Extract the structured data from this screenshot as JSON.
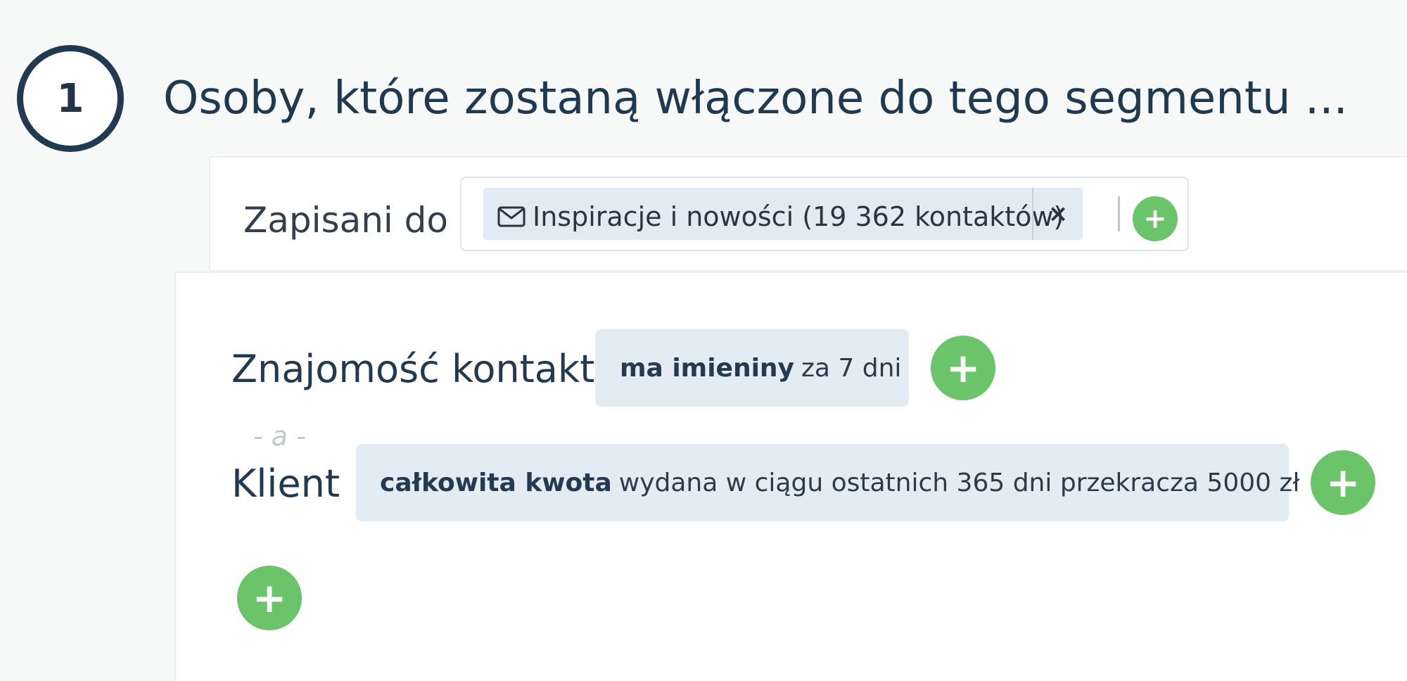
{
  "step": {
    "number": "1",
    "title": "Osoby, które zostaną włączone do tego segmentu ..."
  },
  "subscribed": {
    "label": "Zapisani do",
    "tag_text": "Inspiracje i nowości (19 362 kontaktów)",
    "remove_symbol": "×",
    "add_symbol": "+"
  },
  "conditions": [
    {
      "label": "Znajomość kontaktu",
      "bold": "ma imieniny",
      "rest": "za 7 dni",
      "add_symbol": "+"
    },
    {
      "label": "Klient",
      "bold": "całkowita kwota",
      "rest": "wydana w ciągu ostatnich 365 dni przekracza 5000 zł",
      "add_symbol": "+"
    }
  ],
  "connector": "- a -",
  "add_group_symbol": "+",
  "icons": {
    "list_tag": "envelope-icon"
  },
  "colors": {
    "accent_green": "#6cc46a",
    "chip_background": "#e3ebf3",
    "heading": "#1f3a50"
  }
}
